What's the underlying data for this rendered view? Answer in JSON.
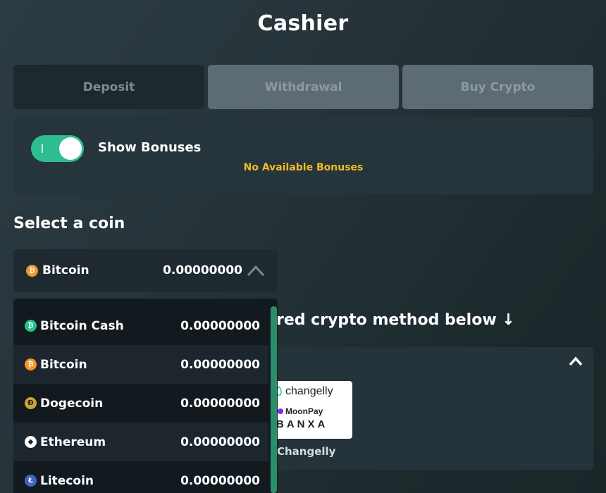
{
  "header": {
    "title": "Cashier"
  },
  "tabs": [
    {
      "label": "Deposit",
      "active": true
    },
    {
      "label": "Withdrawal",
      "active": false
    },
    {
      "label": "Buy Crypto",
      "active": false
    }
  ],
  "bonuses": {
    "toggle_on": true,
    "label": "Show Bonuses",
    "status": "No Available Bonuses"
  },
  "coin_section": {
    "title": "Select a coin",
    "selected": {
      "name": "Bitcoin",
      "balance": "0.00000000",
      "icon": "bitcoin-icon"
    }
  },
  "coin_options": [
    {
      "name": "Bitcoin Cash",
      "balance": "0.00000000",
      "icon": "bitcoin-cash-icon"
    },
    {
      "name": "Bitcoin",
      "balance": "0.00000000",
      "icon": "bitcoin-icon"
    },
    {
      "name": "Dogecoin",
      "balance": "0.00000000",
      "icon": "dogecoin-icon"
    },
    {
      "name": "Ethereum",
      "balance": "0.00000000",
      "icon": "ethereum-icon"
    },
    {
      "name": "Litecoin",
      "balance": "0.00000000",
      "icon": "litecoin-icon"
    }
  ],
  "method_section": {
    "heading_visible": "red crypto method below ↓",
    "provider": {
      "logos": [
        "changelly",
        "MoonPay",
        "BANXA"
      ],
      "label": "Changelly"
    }
  },
  "colors": {
    "accent_green": "#2ebd90",
    "bonus_yellow": "#f2bb27",
    "bitcoin_orange": "#f3962b",
    "litecoin_blue": "#3e67c2"
  }
}
